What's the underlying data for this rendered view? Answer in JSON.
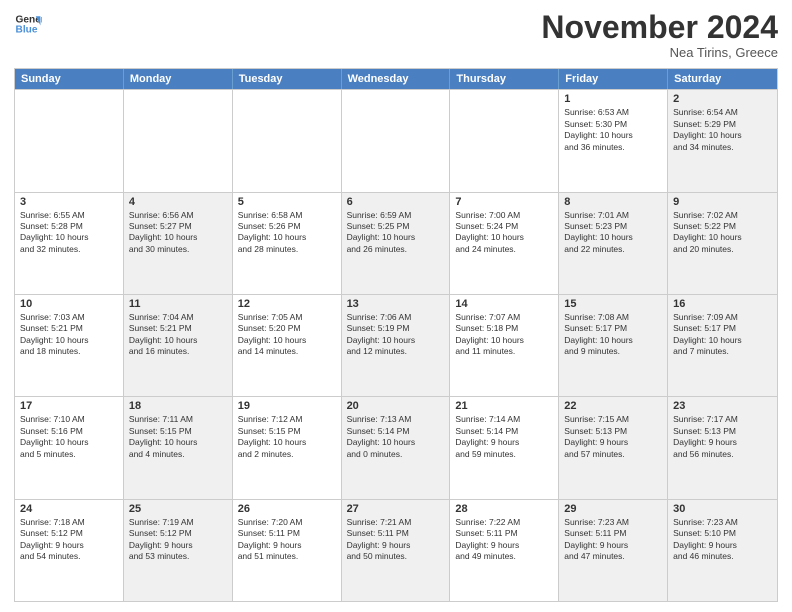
{
  "logo": {
    "line1": "General",
    "line2": "Blue"
  },
  "title": "November 2024",
  "subtitle": "Nea Tirins, Greece",
  "days_of_week": [
    "Sunday",
    "Monday",
    "Tuesday",
    "Wednesday",
    "Thursday",
    "Friday",
    "Saturday"
  ],
  "weeks": [
    {
      "cells": [
        {
          "empty": true
        },
        {
          "empty": true
        },
        {
          "empty": true
        },
        {
          "empty": true
        },
        {
          "empty": true
        },
        {
          "day": "1",
          "info": "Sunrise: 6:53 AM\nSunset: 5:30 PM\nDaylight: 10 hours\nand 36 minutes."
        },
        {
          "day": "2",
          "info": "Sunrise: 6:54 AM\nSunset: 5:29 PM\nDaylight: 10 hours\nand 34 minutes.",
          "shaded": true
        }
      ]
    },
    {
      "cells": [
        {
          "day": "3",
          "info": "Sunrise: 6:55 AM\nSunset: 5:28 PM\nDaylight: 10 hours\nand 32 minutes."
        },
        {
          "day": "4",
          "info": "Sunrise: 6:56 AM\nSunset: 5:27 PM\nDaylight: 10 hours\nand 30 minutes.",
          "shaded": true
        },
        {
          "day": "5",
          "info": "Sunrise: 6:58 AM\nSunset: 5:26 PM\nDaylight: 10 hours\nand 28 minutes."
        },
        {
          "day": "6",
          "info": "Sunrise: 6:59 AM\nSunset: 5:25 PM\nDaylight: 10 hours\nand 26 minutes.",
          "shaded": true
        },
        {
          "day": "7",
          "info": "Sunrise: 7:00 AM\nSunset: 5:24 PM\nDaylight: 10 hours\nand 24 minutes."
        },
        {
          "day": "8",
          "info": "Sunrise: 7:01 AM\nSunset: 5:23 PM\nDaylight: 10 hours\nand 22 minutes.",
          "shaded": true
        },
        {
          "day": "9",
          "info": "Sunrise: 7:02 AM\nSunset: 5:22 PM\nDaylight: 10 hours\nand 20 minutes.",
          "shaded": true
        }
      ]
    },
    {
      "cells": [
        {
          "day": "10",
          "info": "Sunrise: 7:03 AM\nSunset: 5:21 PM\nDaylight: 10 hours\nand 18 minutes."
        },
        {
          "day": "11",
          "info": "Sunrise: 7:04 AM\nSunset: 5:21 PM\nDaylight: 10 hours\nand 16 minutes.",
          "shaded": true
        },
        {
          "day": "12",
          "info": "Sunrise: 7:05 AM\nSunset: 5:20 PM\nDaylight: 10 hours\nand 14 minutes."
        },
        {
          "day": "13",
          "info": "Sunrise: 7:06 AM\nSunset: 5:19 PM\nDaylight: 10 hours\nand 12 minutes.",
          "shaded": true
        },
        {
          "day": "14",
          "info": "Sunrise: 7:07 AM\nSunset: 5:18 PM\nDaylight: 10 hours\nand 11 minutes."
        },
        {
          "day": "15",
          "info": "Sunrise: 7:08 AM\nSunset: 5:17 PM\nDaylight: 10 hours\nand 9 minutes.",
          "shaded": true
        },
        {
          "day": "16",
          "info": "Sunrise: 7:09 AM\nSunset: 5:17 PM\nDaylight: 10 hours\nand 7 minutes.",
          "shaded": true
        }
      ]
    },
    {
      "cells": [
        {
          "day": "17",
          "info": "Sunrise: 7:10 AM\nSunset: 5:16 PM\nDaylight: 10 hours\nand 5 minutes."
        },
        {
          "day": "18",
          "info": "Sunrise: 7:11 AM\nSunset: 5:15 PM\nDaylight: 10 hours\nand 4 minutes.",
          "shaded": true
        },
        {
          "day": "19",
          "info": "Sunrise: 7:12 AM\nSunset: 5:15 PM\nDaylight: 10 hours\nand 2 minutes."
        },
        {
          "day": "20",
          "info": "Sunrise: 7:13 AM\nSunset: 5:14 PM\nDaylight: 10 hours\nand 0 minutes.",
          "shaded": true
        },
        {
          "day": "21",
          "info": "Sunrise: 7:14 AM\nSunset: 5:14 PM\nDaylight: 9 hours\nand 59 minutes."
        },
        {
          "day": "22",
          "info": "Sunrise: 7:15 AM\nSunset: 5:13 PM\nDaylight: 9 hours\nand 57 minutes.",
          "shaded": true
        },
        {
          "day": "23",
          "info": "Sunrise: 7:17 AM\nSunset: 5:13 PM\nDaylight: 9 hours\nand 56 minutes.",
          "shaded": true
        }
      ]
    },
    {
      "cells": [
        {
          "day": "24",
          "info": "Sunrise: 7:18 AM\nSunset: 5:12 PM\nDaylight: 9 hours\nand 54 minutes."
        },
        {
          "day": "25",
          "info": "Sunrise: 7:19 AM\nSunset: 5:12 PM\nDaylight: 9 hours\nand 53 minutes.",
          "shaded": true
        },
        {
          "day": "26",
          "info": "Sunrise: 7:20 AM\nSunset: 5:11 PM\nDaylight: 9 hours\nand 51 minutes."
        },
        {
          "day": "27",
          "info": "Sunrise: 7:21 AM\nSunset: 5:11 PM\nDaylight: 9 hours\nand 50 minutes.",
          "shaded": true
        },
        {
          "day": "28",
          "info": "Sunrise: 7:22 AM\nSunset: 5:11 PM\nDaylight: 9 hours\nand 49 minutes."
        },
        {
          "day": "29",
          "info": "Sunrise: 7:23 AM\nSunset: 5:11 PM\nDaylight: 9 hours\nand 47 minutes.",
          "shaded": true
        },
        {
          "day": "30",
          "info": "Sunrise: 7:23 AM\nSunset: 5:10 PM\nDaylight: 9 hours\nand 46 minutes.",
          "shaded": true
        }
      ]
    }
  ]
}
